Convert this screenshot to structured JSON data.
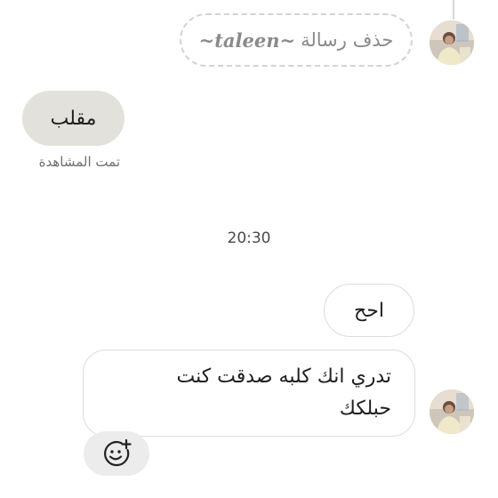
{
  "conversation": {
    "deleted_message": {
      "text": "حذف رسالة",
      "sender": "~taleen~"
    },
    "sent_message": {
      "text": "مقلب",
      "status": "تمت المشاهدة"
    },
    "timestamp": "20:30",
    "received_messages": [
      {
        "text": "احح"
      },
      {
        "line1": "تدري انك كلبه صدقت كنت",
        "line2": "حبلكك"
      }
    ],
    "reaction_button": {
      "icon": "add-reaction-smiley-icon"
    }
  },
  "colors": {
    "sent_bubble": "#e3e1dc",
    "received_border": "#dcdcdc",
    "deleted_text": "#8a8a8a",
    "reaction_bg": "#ececec"
  }
}
